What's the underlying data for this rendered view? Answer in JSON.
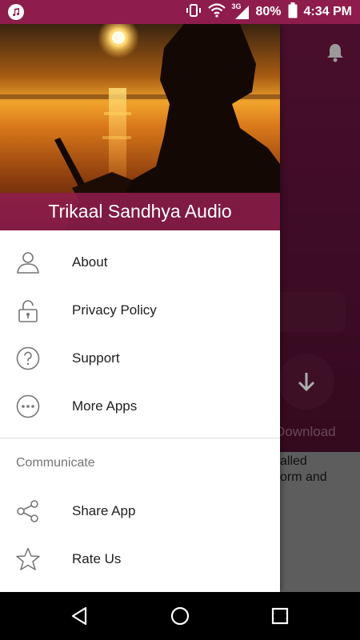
{
  "status_bar": {
    "battery": "80%",
    "network": "3G",
    "time": "4:34 PM",
    "icons": [
      "music-note-icon",
      "vibrate-icon",
      "wifi-icon",
      "signal-icon",
      "battery-icon"
    ]
  },
  "drawer": {
    "title": "Trikaal Sandhya Audio",
    "items": [
      {
        "label": "About",
        "icon": "person-icon"
      },
      {
        "label": "Privacy Policy",
        "icon": "lock-icon"
      },
      {
        "label": "Support",
        "icon": "help-icon"
      },
      {
        "label": "More Apps",
        "icon": "more-icon"
      }
    ],
    "section_title": "Communicate",
    "communicate_items": [
      {
        "label": "Share App",
        "icon": "share-icon"
      },
      {
        "label": "Rate Us",
        "icon": "star-icon"
      }
    ]
  },
  "background": {
    "download_label": "Download",
    "text_line_1": "alled",
    "text_line_2": "orm and"
  },
  "colors": {
    "accent": "#8e1d4c",
    "header_dark": "#4a0e2a"
  }
}
